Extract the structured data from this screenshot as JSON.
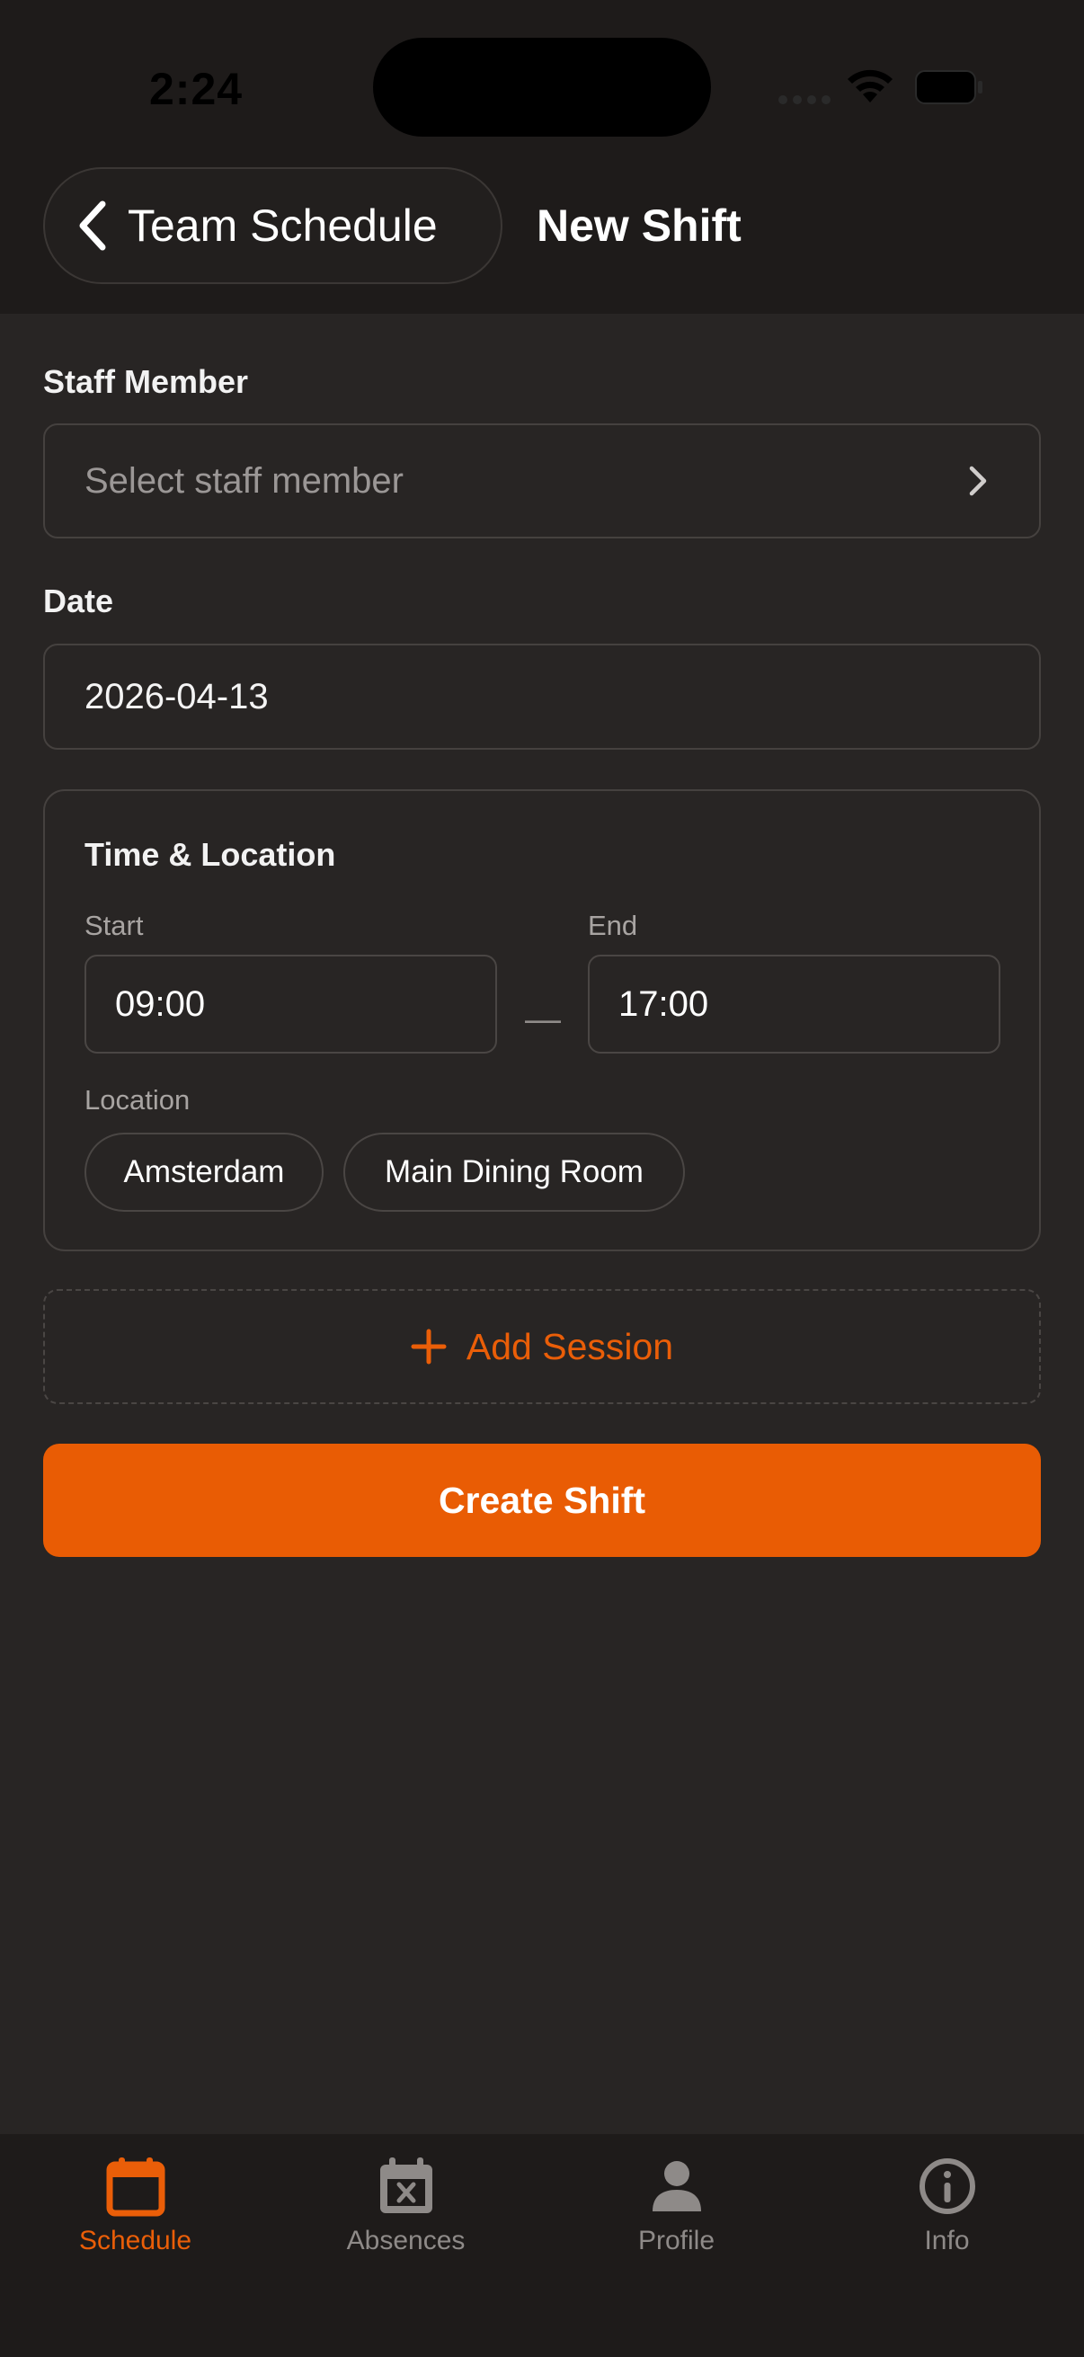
{
  "status_bar": {
    "time": "2:24"
  },
  "nav": {
    "back_label": "Team Schedule",
    "title": "New Shift"
  },
  "form": {
    "staff": {
      "label": "Staff Member",
      "placeholder": "Select staff member"
    },
    "date": {
      "label": "Date",
      "value": "2026-04-13"
    },
    "time_location": {
      "title": "Time & Location",
      "start_label": "Start",
      "start_value": "09:00",
      "end_label": "End",
      "end_value": "17:00",
      "separator": "—",
      "location_label": "Location",
      "locations": [
        "Amsterdam",
        "Main Dining Room"
      ]
    },
    "add_session_label": "Add Session",
    "create_label": "Create Shift"
  },
  "tabs": [
    {
      "label": "Schedule",
      "icon": "calendar-icon",
      "active": true
    },
    {
      "label": "Absences",
      "icon": "calendar-x-icon",
      "active": false
    },
    {
      "label": "Profile",
      "icon": "person-icon",
      "active": false
    },
    {
      "label": "Info",
      "icon": "info-icon",
      "active": false
    }
  ],
  "colors": {
    "accent": "#e95c04",
    "background": "#282524",
    "bar": "#1e1b1a"
  }
}
